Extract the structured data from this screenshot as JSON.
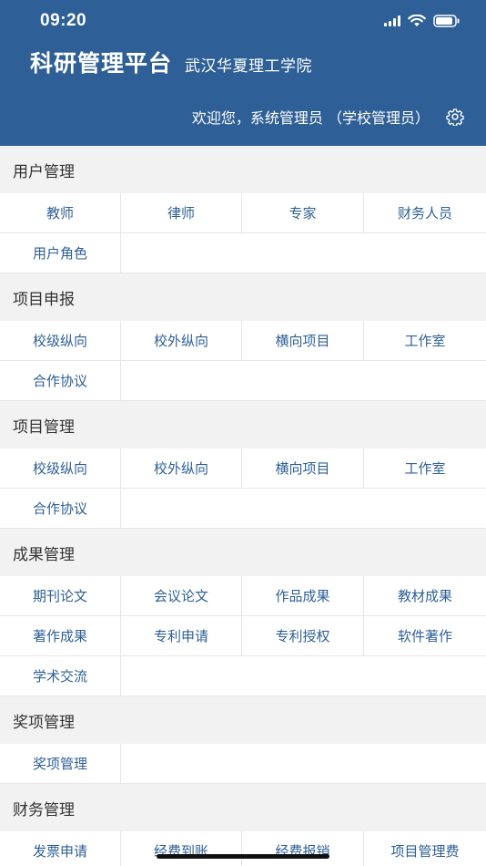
{
  "status": {
    "time": "09:20"
  },
  "header": {
    "title": "科研管理平台",
    "school": "武汉华夏理工学院",
    "welcome": "欢迎您，系统管理员 （学校管理员）",
    "settings_icon": "gear-icon"
  },
  "sections": [
    {
      "title": "用户管理",
      "items": [
        "教师",
        "律师",
        "专家",
        "财务人员",
        "用户角色"
      ]
    },
    {
      "title": "项目申报",
      "items": [
        "校级纵向",
        "校外纵向",
        "横向项目",
        "工作室",
        "合作协议"
      ]
    },
    {
      "title": "项目管理",
      "items": [
        "校级纵向",
        "校外纵向",
        "横向项目",
        "工作室",
        "合作协议"
      ]
    },
    {
      "title": "成果管理",
      "items": [
        "期刊论文",
        "会议论文",
        "作品成果",
        "教材成果",
        "著作成果",
        "专利申请",
        "专利授权",
        "软件著作",
        "学术交流"
      ]
    },
    {
      "title": "奖项管理",
      "items": [
        "奖项管理"
      ]
    },
    {
      "title": "财务管理",
      "items": [
        "发票申请",
        "经费到账",
        "经费报销",
        "项目管理费"
      ]
    }
  ],
  "colors": {
    "header_bg": "#2e5f96",
    "link": "#2e5f96",
    "section_bg": "#f2f2f2"
  }
}
